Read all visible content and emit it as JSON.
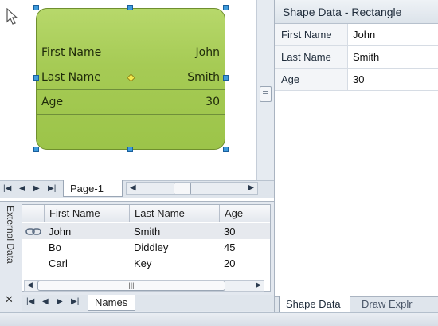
{
  "shape": {
    "rows": [
      {
        "label": "First Name",
        "value": "John"
      },
      {
        "label": "Last Name",
        "value": "Smith"
      },
      {
        "label": "Age",
        "value": "30"
      }
    ],
    "fill_color": "#a6cb55"
  },
  "page_tabs": {
    "active": "Page-1"
  },
  "external_data": {
    "window_label": "External Data",
    "columns": [
      "First Name",
      "Last Name",
      "Age"
    ],
    "rows": [
      {
        "first": "John",
        "last": "Smith",
        "age": "30",
        "linked": true
      },
      {
        "first": "Bo",
        "last": "Diddley",
        "age": "45",
        "linked": false
      },
      {
        "first": "Carl",
        "last": "Key",
        "age": "20",
        "linked": false
      }
    ],
    "sheet_tab": "Names"
  },
  "shape_data_panel": {
    "title": "Shape Data - Rectangle",
    "fields": [
      {
        "key": "First Name",
        "value": "John"
      },
      {
        "key": "Last Name",
        "value": "Smith"
      },
      {
        "key": "Age",
        "value": "30"
      }
    ],
    "tabs": [
      "Shape Data",
      "Draw Explr"
    ]
  },
  "icons": {
    "cursor": "arrow-cursor-icon",
    "link": "link-icon",
    "close": "close-icon"
  },
  "colors": {
    "handle": "#3e9bdc",
    "selected_row": "#e6e9ee"
  }
}
